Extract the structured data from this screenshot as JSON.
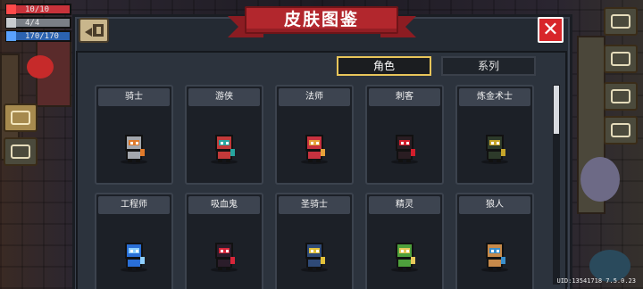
{
  "hud": {
    "hp": "10/10",
    "armor": "4/4",
    "energy": "170/170"
  },
  "panel": {
    "title": "皮肤图鉴",
    "tabs": [
      {
        "label": "角色",
        "active": true
      },
      {
        "label": "系列",
        "active": false
      }
    ]
  },
  "characters": [
    {
      "name": "骑士",
      "icon": "knight-sprite",
      "color": "#a3a7ad",
      "accent": "#e07a2a"
    },
    {
      "name": "游侠",
      "icon": "ranger-sprite",
      "color": "#c23a3a",
      "accent": "#26a6a0"
    },
    {
      "name": "法师",
      "icon": "wizard-sprite",
      "color": "#c8323f",
      "accent": "#e6a23a"
    },
    {
      "name": "刺客",
      "icon": "assassin-sprite",
      "color": "#2a1d22",
      "accent": "#d21e2c"
    },
    {
      "name": "炼金术士",
      "icon": "alchemist-sprite",
      "color": "#2d3a2a",
      "accent": "#c6a52a"
    },
    {
      "name": "工程师",
      "icon": "engineer-sprite",
      "color": "#2a6fd6",
      "accent": "#8fd0ff"
    },
    {
      "name": "吸血鬼",
      "icon": "vampire-sprite",
      "color": "#2b1d2a",
      "accent": "#d8263a"
    },
    {
      "name": "圣骑士",
      "icon": "paladin-sprite",
      "color": "#2f4a76",
      "accent": "#e3c23a"
    },
    {
      "name": "精灵",
      "icon": "elf-sprite",
      "color": "#4ea03c",
      "accent": "#e8c95a"
    },
    {
      "name": "狼人",
      "icon": "werewolf-sprite",
      "color": "#c78a4a",
      "accent": "#3a8fcc"
    }
  ],
  "footer": {
    "uid": "UID:13541718 7.5.0.23"
  },
  "colors": {
    "ribbon": "#b2272d",
    "close": "#d8262a",
    "tab_active_border": "#e8c55a"
  }
}
